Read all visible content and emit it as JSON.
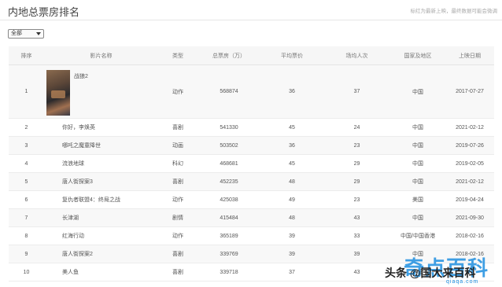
{
  "header": {
    "title": "内地总票房排名",
    "notice": "标红为最新上映，最终数据可能会微调"
  },
  "filter": {
    "value": "全部"
  },
  "columns": [
    "排序",
    "影片名称",
    "类型",
    "总票房（万）",
    "平均票价",
    "场均人次",
    "国家及地区",
    "上映日期"
  ],
  "rows": [
    {
      "rank": "1",
      "name": "战狼2",
      "type": "动作",
      "box": "568874",
      "avg": "36",
      "ppl": "37",
      "country": "中国",
      "date": "2017-07-27"
    },
    {
      "rank": "2",
      "name": "你好，李焕英",
      "type": "喜剧",
      "box": "541330",
      "avg": "45",
      "ppl": "24",
      "country": "中国",
      "date": "2021-02-12"
    },
    {
      "rank": "3",
      "name": "哪吒之魔童降世",
      "type": "动画",
      "box": "503502",
      "avg": "36",
      "ppl": "23",
      "country": "中国",
      "date": "2019-07-26"
    },
    {
      "rank": "4",
      "name": "流浪地球",
      "type": "科幻",
      "box": "468681",
      "avg": "45",
      "ppl": "29",
      "country": "中国",
      "date": "2019-02-05"
    },
    {
      "rank": "5",
      "name": "唐人街探案3",
      "type": "喜剧",
      "box": "452235",
      "avg": "48",
      "ppl": "29",
      "country": "中国",
      "date": "2021-02-12"
    },
    {
      "rank": "6",
      "name": "复仇者联盟4：终局之战",
      "type": "动作",
      "box": "425038",
      "avg": "49",
      "ppl": "23",
      "country": "美国",
      "date": "2019-04-24"
    },
    {
      "rank": "7",
      "name": "长津湖",
      "type": "剧情",
      "box": "415484",
      "avg": "48",
      "ppl": "43",
      "country": "中国",
      "date": "2021-09-30"
    },
    {
      "rank": "8",
      "name": "红海行动",
      "type": "动作",
      "box": "365189",
      "avg": "39",
      "ppl": "33",
      "country": "中国/中国香港",
      "date": "2018-02-16"
    },
    {
      "rank": "9",
      "name": "唐人街探案2",
      "type": "喜剧",
      "box": "339769",
      "avg": "39",
      "ppl": "39",
      "country": "中国",
      "date": "2018-02-16"
    },
    {
      "rank": "10",
      "name": "美人鱼",
      "type": "喜剧",
      "box": "339718",
      "avg": "37",
      "ppl": "43",
      "country": "中国",
      "date": ""
    }
  ],
  "watermark": {
    "author": "头条 @国大来百科",
    "brand": "奇点百科",
    "site": "qiaqa.com"
  }
}
